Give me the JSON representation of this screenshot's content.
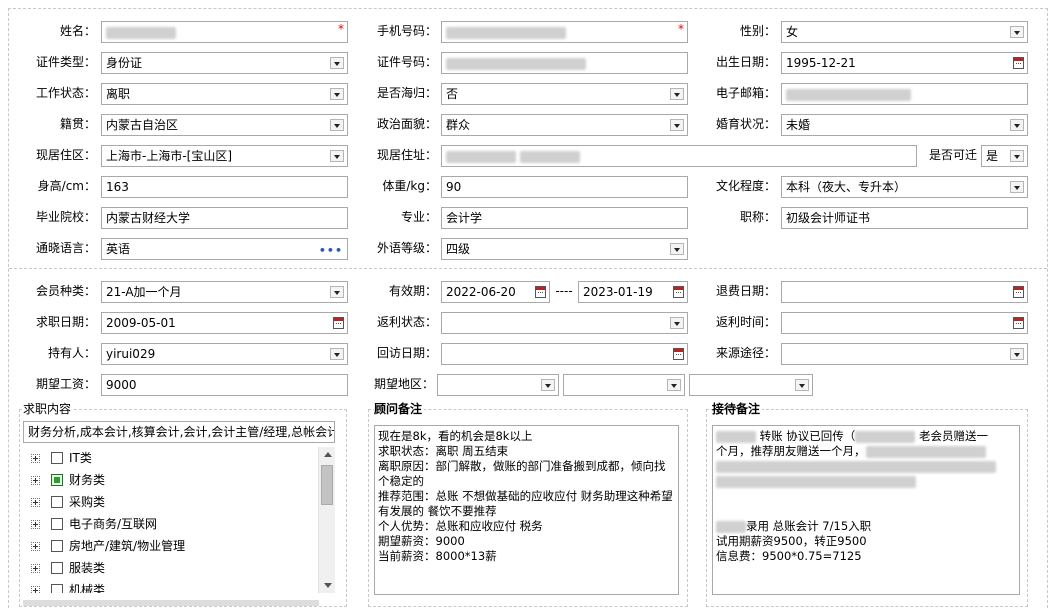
{
  "fields": {
    "name_label": "姓名：",
    "phone_label": "手机号码：",
    "gender_label": "性别：",
    "gender_value": "女",
    "idtype_label": "证件类型：",
    "idtype_value": "身份证",
    "idno_label": "证件号码：",
    "birth_label": "出生日期：",
    "birth_value": "1995-12-21",
    "workstatus_label": "工作状态：",
    "workstatus_value": "离职",
    "returnee_label": "是否海归：",
    "returnee_value": "否",
    "email_label": "电子邮箱：",
    "native_label": "籍贯：",
    "native_value": "内蒙古自治区",
    "political_label": "政治面貌：",
    "political_value": "群众",
    "marital_label": "婚育状况：",
    "marital_value": "未婚",
    "residence_label": "现居住区：",
    "residence_value": "上海市-上海市-[宝山区]",
    "address_label": "现居住址：",
    "canchange_label": "是否可迁",
    "canchange_value": "是",
    "height_label": "身高/cm：",
    "height_value": "163",
    "weight_label": "体重/kg：",
    "weight_value": "90",
    "edu_label": "文化程度：",
    "edu_value": "本科（夜大、专升本）",
    "school_label": "毕业院校：",
    "school_value": "内蒙古财经大学",
    "major_label": "专业：",
    "major_value": "会计学",
    "title_label": "职称：",
    "title_value": "初级会计师证书",
    "lang_label": "通晓语言：",
    "lang_value": "英语",
    "lang_more": "•••",
    "foreign_label": "外语等级：",
    "foreign_value": "四级"
  },
  "member": {
    "type_label": "会员种类：",
    "type_value": "21-A加一个月",
    "valid_label": "有效期：",
    "valid_from": "2022-06-20",
    "valid_sep": "----",
    "valid_to": "2023-01-19",
    "refund_label": "退费日期：",
    "jobdate_label": "求职日期：",
    "jobdate_value": "2009-05-01",
    "rebate_status_label": "返利状态：",
    "rebate_time_label": "返利时间：",
    "holder_label": "持有人：",
    "holder_value": "yirui029",
    "visit_label": "回访日期：",
    "source_label": "来源途径：",
    "salary_label": "期望工资：",
    "salary_value": "9000",
    "region_label": "期望地区："
  },
  "job_panel": {
    "title": "求职内容",
    "summary": "财务分析,成本会计,核算会计,会计,会计主管/经理,总帐会计",
    "categories": [
      {
        "label": "IT类",
        "checked": false
      },
      {
        "label": "财务类",
        "checked": true
      },
      {
        "label": "采购类",
        "checked": false
      },
      {
        "label": "电子商务/互联网",
        "checked": false
      },
      {
        "label": "房地产/建筑/物业管理",
        "checked": false
      },
      {
        "label": "服装类",
        "checked": false
      },
      {
        "label": "机械类",
        "checked": false
      }
    ]
  },
  "advisor_panel": {
    "title": "顾问备注",
    "text": "现在是8k，看的机会是8k以上\n求职状态：离职 周五结束\n离职原因：部门解散，做账的部门准备搬到成都，倾向找个稳定的\n推荐范围：总账 不想做基础的应收应付 财务助理这种希望有发展的 餐饮不要推荐\n个人优势：总账和应收应付 税务\n期望薪资：9000\n当前薪资：8000*13薪"
  },
  "reception_panel": {
    "title": "接待备注",
    "line1_a": "转账 协议已回传（",
    "line1_b": "老会员赠送一",
    "line2": "个月，推荐朋友赠送一个月，",
    "line3_a": "录用 总账会计  7/15入职",
    "line4": "试用期薪资9500，转正9500",
    "line5": "信息费：9500*0.75=7125"
  },
  "colors": {
    "required": "#e00000",
    "border": "#a9a9a9",
    "checked": "#2aa02a",
    "link": "#2b57b8"
  }
}
